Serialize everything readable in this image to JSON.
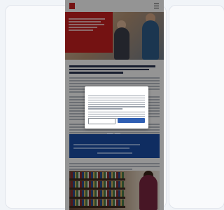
{
  "site": {
    "logo_text": "",
    "logo_sub": ""
  },
  "hero": {
    "headline": ""
  },
  "article": {
    "heading": ""
  },
  "promo": {
    "title": ""
  },
  "consent": {
    "title": "",
    "decline_label": "",
    "accept_label": ""
  },
  "colors": {
    "brand_red": "#c8201f",
    "promo_blue": "#1a4ea8",
    "accept_blue": "#2f5fb3"
  }
}
